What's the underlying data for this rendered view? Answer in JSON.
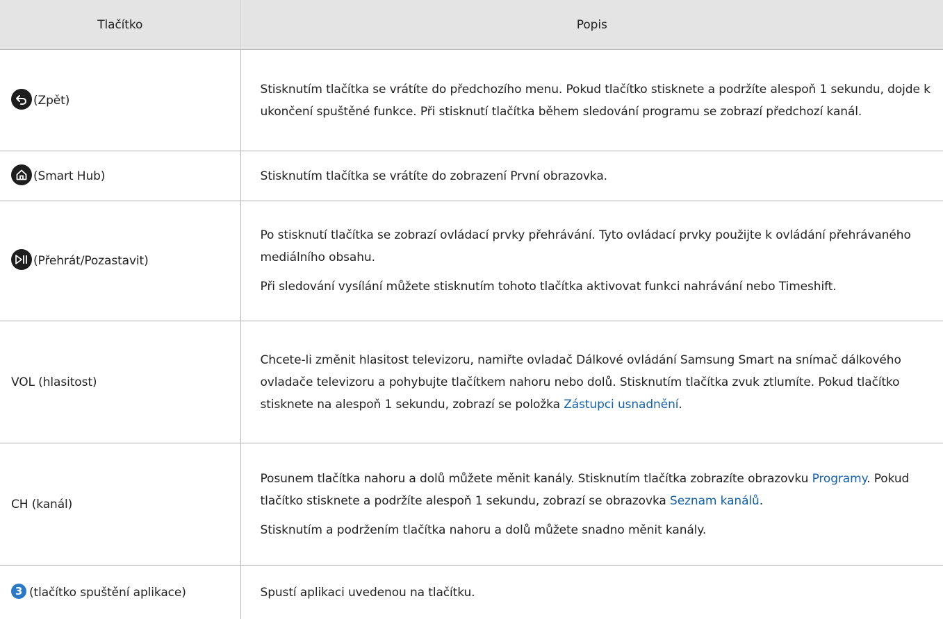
{
  "header": {
    "col_button": "Tlačítko",
    "col_description": "Popis"
  },
  "rows": [
    {
      "icon": "back-arrow-icon",
      "button": "(Zpět)",
      "description": [
        "Stisknutím tlačítka se vrátíte do předchozího menu. Pokud tlačítko stisknete a podržíte alespoň 1 sekundu, dojde k ukončení spuštěné funkce. Při stisknutí tlačítka během sledování programu se zobrazí předchozí kanál."
      ]
    },
    {
      "icon": "home-icon",
      "button": "(Smart Hub)",
      "description": [
        "Stisknutím tlačítka se vrátíte do zobrazení První obrazovka."
      ]
    },
    {
      "icon": "play-pause-icon",
      "button": "(Přehrát/Pozastavit)",
      "description": [
        "Po stisknutí tlačítka se zobrazí ovládací prvky přehrávání. Tyto ovládací prvky použijte k ovládání přehrávaného mediálního obsahu.",
        "Při sledování vysílání můžete stisknutím tohoto tlačítka aktivovat funkci nahrávání nebo Timeshift."
      ]
    },
    {
      "button": "VOL (hlasitost)",
      "description_pre": "Chcete-li změnit hlasitost televizoru, namiřte ovladač Dálkové ovládání Samsung Smart na snímač dálkového ovladače televizoru a pohybujte tlačítkem nahoru nebo dolů. Stisknutím tlačítka zvuk ztlumíte. Pokud tlačítko stisknete na alespoň 1 sekundu, zobrazí se položka ",
      "link": "Zástupci usnadnění",
      "description_post": "."
    },
    {
      "button": "CH (kanál)",
      "p1_a": "Posunem tlačítka nahoru a dolů můžete měnit kanály. Stisknutím tlačítka zobrazíte obrazovku ",
      "p1_link1": "Programy",
      "p1_b": ". Pokud tlačítko stisknete a podržíte alespoň 1 sekundu, zobrazí se obrazovka ",
      "p1_link2": "Seznam kanálů",
      "p1_c": ".",
      "p2": "Stisknutím a podržením tlačítka nahoru a dolů můžete snadno měnit kanály."
    },
    {
      "icon_number": "3",
      "button": "(tlačítko spuštění aplikace)",
      "description": [
        "Spustí aplikaci uvedenou na tlačítku."
      ]
    }
  ],
  "colors": {
    "header_bg": "#e4e4e4",
    "link": "#1360a8",
    "number_badge": "#2a79c9"
  }
}
